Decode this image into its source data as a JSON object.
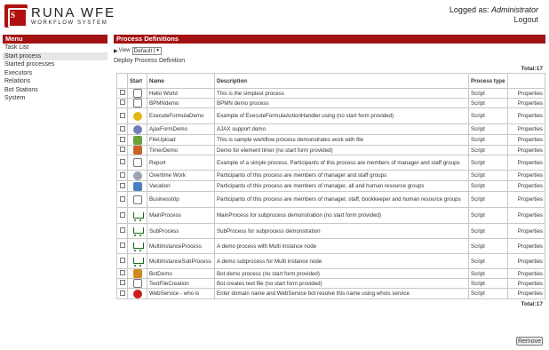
{
  "logo": {
    "mark": "S",
    "title": "RUNA WFE",
    "subtitle": "WORKFLOW SYSTEM"
  },
  "user": {
    "logged_as_label": "Logged as:",
    "username": "Administrator",
    "logout_label": "Logout"
  },
  "menu": {
    "title": "Menu",
    "items": [
      {
        "label": "Task List",
        "active": false
      },
      {
        "label": "Start process",
        "active": true
      },
      {
        "label": "Started processes",
        "active": false
      },
      {
        "label": "Executors",
        "active": false
      },
      {
        "label": "Relations",
        "active": false
      },
      {
        "label": "Bot Stations",
        "active": false
      },
      {
        "label": "System",
        "active": false
      }
    ]
  },
  "main": {
    "title": "Process Definitions",
    "view_label": "View",
    "view_selected": "Default",
    "deploy_label": "Deploy Process Definition",
    "total_top": "Total:17",
    "total_bottom": "Total:17",
    "remove_label": "Remove",
    "columns": {
      "start": "Start",
      "name": "Name",
      "description": "Description",
      "process_type": "Process type"
    },
    "rows": [
      {
        "name": "Hello World",
        "description": "This is the simplest process",
        "type": "Script",
        "action": "Properties",
        "icon": "hello-world-icon",
        "icon_color": "#ffffff",
        "icon_shape": "doc"
      },
      {
        "name": "BPMNdemo",
        "description": "BPMN demo process",
        "type": "Script",
        "action": "Properties",
        "icon": "bpmn-icon",
        "icon_color": "#ffffff",
        "icon_shape": "doc"
      },
      {
        "name": "ExecuteFormulaDemo",
        "description": "Example of ExecuteFormulaActionHandler using (no start form provided)",
        "type": "Script",
        "action": "Properties",
        "icon": "formula-icon",
        "icon_color": "#e0b814",
        "icon_shape": "round"
      },
      {
        "name": "AjaxFormDemo",
        "description": "AJAX support demo",
        "type": "Script",
        "action": "Properties",
        "icon": "ajax-icon",
        "icon_color": "#6d7fb5",
        "icon_shape": "round"
      },
      {
        "name": "FileUpload",
        "description": "This is sample workflow process demonstrates work with file",
        "type": "Script",
        "action": "Properties",
        "icon": "file-upload-icon",
        "icon_color": "#6aa23c",
        "icon_shape": "box"
      },
      {
        "name": "TimerDemo",
        "description": "Demo for element timer (no start form provided)",
        "type": "Script",
        "action": "Properties",
        "icon": "timer-icon",
        "icon_color": "#c9612a",
        "icon_shape": "box"
      },
      {
        "name": "Report",
        "description": "Example of a simple process. Participants of this process are members of manager and staff groups",
        "type": "Script",
        "action": "Properties",
        "icon": "report-icon",
        "icon_color": "#ffffff",
        "icon_shape": "doc"
      },
      {
        "name": "Overtime Work",
        "description": "Participants of this process are members of manager and staff groups",
        "type": "Script",
        "action": "Properties",
        "icon": "overtime-icon",
        "icon_color": "#9aa3b5",
        "icon_shape": "round"
      },
      {
        "name": "Vacation",
        "description": "Participants of this process are members of manager, all and human resource groups",
        "type": "Script",
        "action": "Properties",
        "icon": "vacation-icon",
        "icon_color": "#4a7fc0",
        "icon_shape": "box"
      },
      {
        "name": "Businesstrip",
        "description": "Participants of this process are members of manager, staff, bookkeeper and human resource groups",
        "type": "Script",
        "action": "Properties",
        "icon": "businesstrip-icon",
        "icon_color": "#ffffff",
        "icon_shape": "doc"
      },
      {
        "name": "MainProcess",
        "description": "MainProcess for subprocess demonstration (no start form provided)",
        "type": "Script",
        "action": "Properties",
        "icon": "cart-icon",
        "icon_color": "#1a6b1a",
        "icon_shape": "cart"
      },
      {
        "name": "SubProcess",
        "description": "SubProcess for subprocess demonstration",
        "type": "Script",
        "action": "Properties",
        "icon": "cart-icon",
        "icon_color": "#1a6b1a",
        "icon_shape": "cart"
      },
      {
        "name": "MultiInstanceProcess",
        "description": "A demo process with Multi instance node",
        "type": "Script",
        "action": "Properties",
        "icon": "cart-icon",
        "icon_color": "#1a6b1a",
        "icon_shape": "cart"
      },
      {
        "name": "MultiInstanceSubProcess",
        "description": "A demo subprocess for Multi instance node",
        "type": "Script",
        "action": "Properties",
        "icon": "cart-icon",
        "icon_color": "#1a6b1a",
        "icon_shape": "cart"
      },
      {
        "name": "BotDemo",
        "description": "Bot demo process (no start form provided)",
        "type": "Script",
        "action": "Properties",
        "icon": "bot-icon",
        "icon_color": "#d18a1f",
        "icon_shape": "box"
      },
      {
        "name": "TextFileCreation",
        "description": "Bot creates text file (no start form provided)",
        "type": "Script",
        "action": "Properties",
        "icon": "text-file-icon",
        "icon_color": "#ffffff",
        "icon_shape": "doc"
      },
      {
        "name": "WebService - who is",
        "description": "Enter domain name and WebService bot resolve this name using whois service",
        "type": "Script",
        "action": "Properties",
        "icon": "webservice-icon",
        "icon_color": "#c82020",
        "icon_shape": "round"
      }
    ]
  }
}
